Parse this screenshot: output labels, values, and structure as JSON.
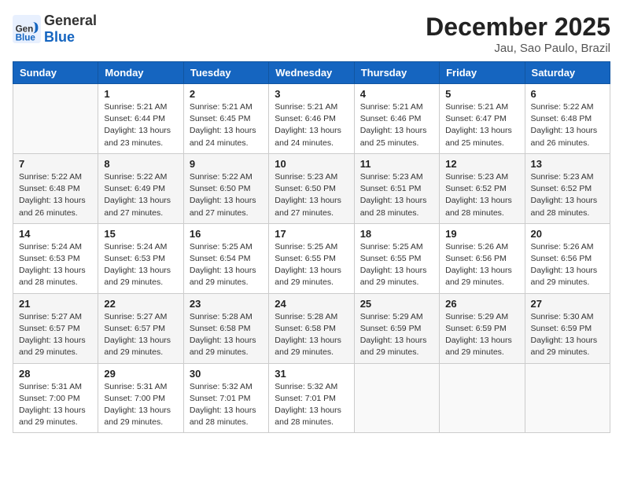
{
  "logo": {
    "general": "General",
    "blue": "Blue"
  },
  "header": {
    "month": "December 2025",
    "location": "Jau, Sao Paulo, Brazil"
  },
  "weekdays": [
    "Sunday",
    "Monday",
    "Tuesday",
    "Wednesday",
    "Thursday",
    "Friday",
    "Saturday"
  ],
  "weeks": [
    [
      {
        "day": "",
        "info": ""
      },
      {
        "day": "1",
        "info": "Sunrise: 5:21 AM\nSunset: 6:44 PM\nDaylight: 13 hours\nand 23 minutes."
      },
      {
        "day": "2",
        "info": "Sunrise: 5:21 AM\nSunset: 6:45 PM\nDaylight: 13 hours\nand 24 minutes."
      },
      {
        "day": "3",
        "info": "Sunrise: 5:21 AM\nSunset: 6:46 PM\nDaylight: 13 hours\nand 24 minutes."
      },
      {
        "day": "4",
        "info": "Sunrise: 5:21 AM\nSunset: 6:46 PM\nDaylight: 13 hours\nand 25 minutes."
      },
      {
        "day": "5",
        "info": "Sunrise: 5:21 AM\nSunset: 6:47 PM\nDaylight: 13 hours\nand 25 minutes."
      },
      {
        "day": "6",
        "info": "Sunrise: 5:22 AM\nSunset: 6:48 PM\nDaylight: 13 hours\nand 26 minutes."
      }
    ],
    [
      {
        "day": "7",
        "info": "Sunrise: 5:22 AM\nSunset: 6:48 PM\nDaylight: 13 hours\nand 26 minutes."
      },
      {
        "day": "8",
        "info": "Sunrise: 5:22 AM\nSunset: 6:49 PM\nDaylight: 13 hours\nand 27 minutes."
      },
      {
        "day": "9",
        "info": "Sunrise: 5:22 AM\nSunset: 6:50 PM\nDaylight: 13 hours\nand 27 minutes."
      },
      {
        "day": "10",
        "info": "Sunrise: 5:23 AM\nSunset: 6:50 PM\nDaylight: 13 hours\nand 27 minutes."
      },
      {
        "day": "11",
        "info": "Sunrise: 5:23 AM\nSunset: 6:51 PM\nDaylight: 13 hours\nand 28 minutes."
      },
      {
        "day": "12",
        "info": "Sunrise: 5:23 AM\nSunset: 6:52 PM\nDaylight: 13 hours\nand 28 minutes."
      },
      {
        "day": "13",
        "info": "Sunrise: 5:23 AM\nSunset: 6:52 PM\nDaylight: 13 hours\nand 28 minutes."
      }
    ],
    [
      {
        "day": "14",
        "info": "Sunrise: 5:24 AM\nSunset: 6:53 PM\nDaylight: 13 hours\nand 28 minutes."
      },
      {
        "day": "15",
        "info": "Sunrise: 5:24 AM\nSunset: 6:53 PM\nDaylight: 13 hours\nand 29 minutes."
      },
      {
        "day": "16",
        "info": "Sunrise: 5:25 AM\nSunset: 6:54 PM\nDaylight: 13 hours\nand 29 minutes."
      },
      {
        "day": "17",
        "info": "Sunrise: 5:25 AM\nSunset: 6:55 PM\nDaylight: 13 hours\nand 29 minutes."
      },
      {
        "day": "18",
        "info": "Sunrise: 5:25 AM\nSunset: 6:55 PM\nDaylight: 13 hours\nand 29 minutes."
      },
      {
        "day": "19",
        "info": "Sunrise: 5:26 AM\nSunset: 6:56 PM\nDaylight: 13 hours\nand 29 minutes."
      },
      {
        "day": "20",
        "info": "Sunrise: 5:26 AM\nSunset: 6:56 PM\nDaylight: 13 hours\nand 29 minutes."
      }
    ],
    [
      {
        "day": "21",
        "info": "Sunrise: 5:27 AM\nSunset: 6:57 PM\nDaylight: 13 hours\nand 29 minutes."
      },
      {
        "day": "22",
        "info": "Sunrise: 5:27 AM\nSunset: 6:57 PM\nDaylight: 13 hours\nand 29 minutes."
      },
      {
        "day": "23",
        "info": "Sunrise: 5:28 AM\nSunset: 6:58 PM\nDaylight: 13 hours\nand 29 minutes."
      },
      {
        "day": "24",
        "info": "Sunrise: 5:28 AM\nSunset: 6:58 PM\nDaylight: 13 hours\nand 29 minutes."
      },
      {
        "day": "25",
        "info": "Sunrise: 5:29 AM\nSunset: 6:59 PM\nDaylight: 13 hours\nand 29 minutes."
      },
      {
        "day": "26",
        "info": "Sunrise: 5:29 AM\nSunset: 6:59 PM\nDaylight: 13 hours\nand 29 minutes."
      },
      {
        "day": "27",
        "info": "Sunrise: 5:30 AM\nSunset: 6:59 PM\nDaylight: 13 hours\nand 29 minutes."
      }
    ],
    [
      {
        "day": "28",
        "info": "Sunrise: 5:31 AM\nSunset: 7:00 PM\nDaylight: 13 hours\nand 29 minutes."
      },
      {
        "day": "29",
        "info": "Sunrise: 5:31 AM\nSunset: 7:00 PM\nDaylight: 13 hours\nand 29 minutes."
      },
      {
        "day": "30",
        "info": "Sunrise: 5:32 AM\nSunset: 7:01 PM\nDaylight: 13 hours\nand 28 minutes."
      },
      {
        "day": "31",
        "info": "Sunrise: 5:32 AM\nSunset: 7:01 PM\nDaylight: 13 hours\nand 28 minutes."
      },
      {
        "day": "",
        "info": ""
      },
      {
        "day": "",
        "info": ""
      },
      {
        "day": "",
        "info": ""
      }
    ]
  ]
}
